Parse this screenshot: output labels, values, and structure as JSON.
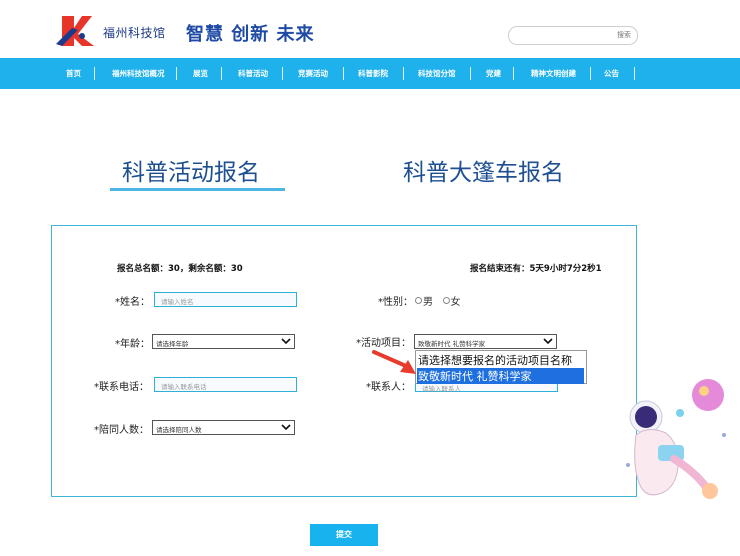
{
  "header": {
    "site_name": "福州科技馆",
    "slogan": "智慧 创新 未来",
    "search": {
      "button_label": "搜索"
    }
  },
  "nav": {
    "items": [
      "首页",
      "福州科技馆概况",
      "展览",
      "科普活动",
      "竞赛活动",
      "科普影院",
      "科技馆分馆",
      "党建",
      "精神文明创建",
      "公告"
    ]
  },
  "tabs": [
    "科普活动报名",
    "科普大篷车报名"
  ],
  "form": {
    "quota_text": "报名总名额：30，剩余名额：30",
    "countdown_text": "报名结束还有：5天9小时7分2秒1",
    "name": {
      "label": "*姓名：",
      "placeholder": "请输入姓名"
    },
    "gender": {
      "label": "*性别：",
      "options": [
        "男",
        "女"
      ]
    },
    "age": {
      "label": "*年龄：",
      "value": "请选择年龄"
    },
    "project": {
      "label": "*活动项目：",
      "value": "致敬新时代 礼赞科学家",
      "options": [
        "请选择想要报名的活动项目名称",
        "致敬新时代 礼赞科学家"
      ]
    },
    "phone": {
      "label": "*联系电话：",
      "placeholder": "请输入联系电话"
    },
    "contact": {
      "label": "*联系人：",
      "placeholder": "请输入联系人"
    },
    "companions": {
      "label": "*陪同人数：",
      "value": "请选择陪同人数"
    },
    "submit_label": "提交"
  },
  "colors": {
    "nav_bg": "#1fb1ec",
    "accent": "#1d4f91",
    "highlight": "#1e6fe0"
  }
}
